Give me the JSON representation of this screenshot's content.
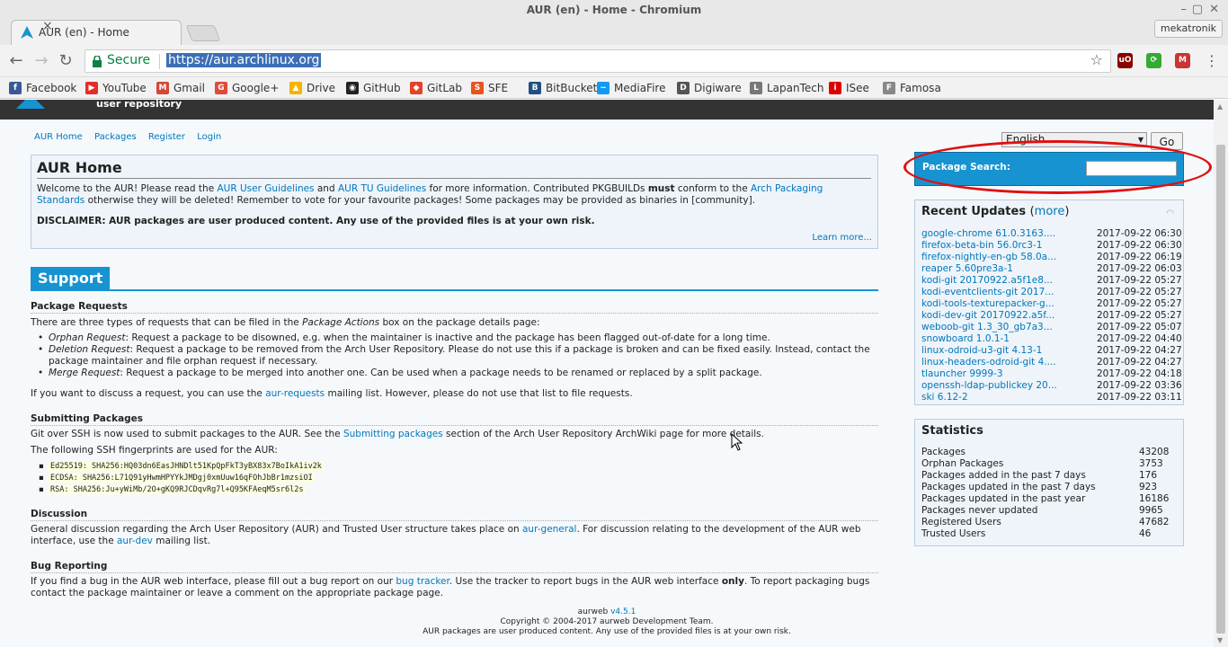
{
  "window": {
    "title": "AUR (en) - Home - Chromium",
    "profile": "mekatronik"
  },
  "tab": {
    "title": "AUR (en) - Home",
    "close": "×"
  },
  "omnibox": {
    "secure": "Secure",
    "url": "https://aur.archlinux.org"
  },
  "bookmarks": [
    {
      "label": "Facebook",
      "icon": "facebook-icon",
      "color": "#3b5998",
      "glyph": "f"
    },
    {
      "label": "YouTube",
      "icon": "youtube-icon",
      "color": "#e52d27",
      "glyph": "▶"
    },
    {
      "label": "Gmail",
      "icon": "gmail-icon",
      "color": "#d44638",
      "glyph": "M"
    },
    {
      "label": "Google+",
      "icon": "google-plus-icon",
      "color": "#dd4b39",
      "glyph": "G"
    },
    {
      "label": "Drive",
      "icon": "drive-icon",
      "color": "#f4b400",
      "glyph": "▲"
    },
    {
      "label": "GitHub",
      "icon": "github-icon",
      "color": "#222",
      "glyph": "◉"
    },
    {
      "label": "GitLab",
      "icon": "gitlab-icon",
      "color": "#e24329",
      "glyph": "◆"
    },
    {
      "label": "SFE",
      "icon": "sfe-icon",
      "color": "#e8541e",
      "glyph": "S"
    },
    {
      "label": "BitBucket",
      "icon": "bitbucket-icon",
      "color": "#205081",
      "glyph": "B"
    },
    {
      "label": "MediaFire",
      "icon": "mediafire-icon",
      "color": "#1299f3",
      "glyph": "~"
    },
    {
      "label": "Digiware",
      "icon": "digiware-icon",
      "color": "#555",
      "glyph": "D"
    },
    {
      "label": "LapanTech",
      "icon": "lapantech-icon",
      "color": "#777",
      "glyph": "L"
    },
    {
      "label": "ISee",
      "icon": "isee-icon",
      "color": "#d00",
      "glyph": "i"
    },
    {
      "label": "Famosa",
      "icon": "famosa-icon",
      "color": "#888",
      "glyph": "F"
    }
  ],
  "header": {
    "subtitle": "user repository"
  },
  "nav": [
    "AUR Home",
    "Packages",
    "Register",
    "Login"
  ],
  "home": {
    "title": "AUR Home",
    "p1_a": "Welcome to the AUR! Please read the ",
    "p1_l1": "AUR User Guidelines",
    "p1_b": " and ",
    "p1_l2": "AUR TU Guidelines",
    "p1_c": " for more information. Contributed PKGBUILDs ",
    "p1_must": "must",
    "p1_d": " conform to the ",
    "p1_l3": "Arch Packaging Standards",
    "p1_e": " otherwise they will be deleted! Remember to vote for your favourite packages! Some packages may be provided as binaries in [community].",
    "disclaimer": "DISCLAIMER: AUR packages are user produced content. Any use of the provided files is at your own risk.",
    "learn_more": "Learn more..."
  },
  "support": {
    "title": "Support",
    "req_title": "Package Requests",
    "req_intro_a": "There are three types of requests that can be filed in the ",
    "req_intro_em": "Package Actions",
    "req_intro_b": " box on the package details page:",
    "orphan_em": "Orphan Request",
    "orphan_text": ": Request a package to be disowned, e.g. when the maintainer is inactive and the package has been flagged out-of-date for a long time.",
    "deletion_em": "Deletion Request",
    "deletion_text": ": Request a package to be removed from the Arch User Repository. Please do not use this if a package is broken and can be fixed easily. Instead, contact the package maintainer and file orphan request if necessary.",
    "merge_em": "Merge Request",
    "merge_text": ": Request a package to be merged into another one. Can be used when a package needs to be renamed or replaced by a split package.",
    "discuss_a": "If you want to discuss a request, you can use the ",
    "discuss_link": "aur-requests",
    "discuss_b": " mailing list. However, please do not use that list to file requests.",
    "sub_title": "Submitting Packages",
    "sub_a": "Git over SSH is now used to submit packages to the AUR. See the ",
    "sub_link": "Submitting packages",
    "sub_b": " section of the Arch User Repository ArchWiki page for more details.",
    "fp_intro": "The following SSH fingerprints are used for the AUR:",
    "fingerprints": [
      "Ed25519: SHA256:HQ03dn6EasJHNDlt51KpQpFkT3yBX83x7BoIkA1iv2k",
      "ECDSA: SHA256:L71Q91yHwmHPYYkJMDgj0xmUuw16qFOhJbBr1mzsiOI",
      "RSA: SHA256:Ju+yWiMb/2O+gKQ9RJCDqvRg7l+Q95KFAeqM5sr6l2s"
    ],
    "disc_title": "Discussion",
    "disc_a": "General discussion regarding the Arch User Repository (AUR) and Trusted User structure takes place on ",
    "disc_link1": "aur-general",
    "disc_b": ". For discussion relating to the development of the AUR web interface, use the ",
    "disc_link2": "aur-dev",
    "disc_c": " mailing list.",
    "bug_title": "Bug Reporting",
    "bug_a": "If you find a bug in the AUR web interface, please fill out a bug report on our ",
    "bug_link": "bug tracker",
    "bug_b": ". Use the tracker to report bugs in the AUR web interface ",
    "bug_only": "only",
    "bug_c": ". To report packaging bugs contact the package maintainer or leave a comment on the appropriate package page."
  },
  "footer": {
    "aurweb": "aurweb ",
    "version": "v4.5.1",
    "copyright": "Copyright © 2004-2017 aurweb Development Team.",
    "note": "AUR packages are user produced content. Any use of the provided files is at your own risk."
  },
  "language": {
    "selected": "English",
    "go": "Go"
  },
  "search": {
    "label": "Package Search:",
    "value": ""
  },
  "recent": {
    "title": "Recent Updates",
    "more": "more",
    "items": [
      {
        "name": "google-chrome 61.0.3163....",
        "date": "2017-09-22 06:30"
      },
      {
        "name": "firefox-beta-bin 56.0rc3-1",
        "date": "2017-09-22 06:30"
      },
      {
        "name": "firefox-nightly-en-gb 58.0a...",
        "date": "2017-09-22 06:19"
      },
      {
        "name": "reaper 5.60pre3a-1",
        "date": "2017-09-22 06:03"
      },
      {
        "name": "kodi-git 20170922.a5f1e8...",
        "date": "2017-09-22 05:27"
      },
      {
        "name": "kodi-eventclients-git 2017...",
        "date": "2017-09-22 05:27"
      },
      {
        "name": "kodi-tools-texturepacker-g...",
        "date": "2017-09-22 05:27"
      },
      {
        "name": "kodi-dev-git 20170922.a5f...",
        "date": "2017-09-22 05:27"
      },
      {
        "name": "weboob-git 1.3_30_gb7a3...",
        "date": "2017-09-22 05:07"
      },
      {
        "name": "snowboard 1.0.1-1",
        "date": "2017-09-22 04:40"
      },
      {
        "name": "linux-odroid-u3-git 4.13-1",
        "date": "2017-09-22 04:27"
      },
      {
        "name": "linux-headers-odroid-git 4....",
        "date": "2017-09-22 04:27"
      },
      {
        "name": "tlauncher 9999-3",
        "date": "2017-09-22 04:18"
      },
      {
        "name": "openssh-ldap-publickey 20...",
        "date": "2017-09-22 03:36"
      },
      {
        "name": "ski 6.12-2",
        "date": "2017-09-22 03:11"
      }
    ]
  },
  "stats": {
    "title": "Statistics",
    "rows": [
      {
        "label": "Packages",
        "value": "43208"
      },
      {
        "label": "Orphan Packages",
        "value": "3753"
      },
      {
        "label": "Packages added in the past 7 days",
        "value": "176"
      },
      {
        "label": "Packages updated in the past 7 days",
        "value": "923"
      },
      {
        "label": "Packages updated in the past year",
        "value": "16186"
      },
      {
        "label": "Packages never updated",
        "value": "9965"
      },
      {
        "label": "Registered Users",
        "value": "47682"
      },
      {
        "label": "Trusted Users",
        "value": "46"
      }
    ]
  }
}
